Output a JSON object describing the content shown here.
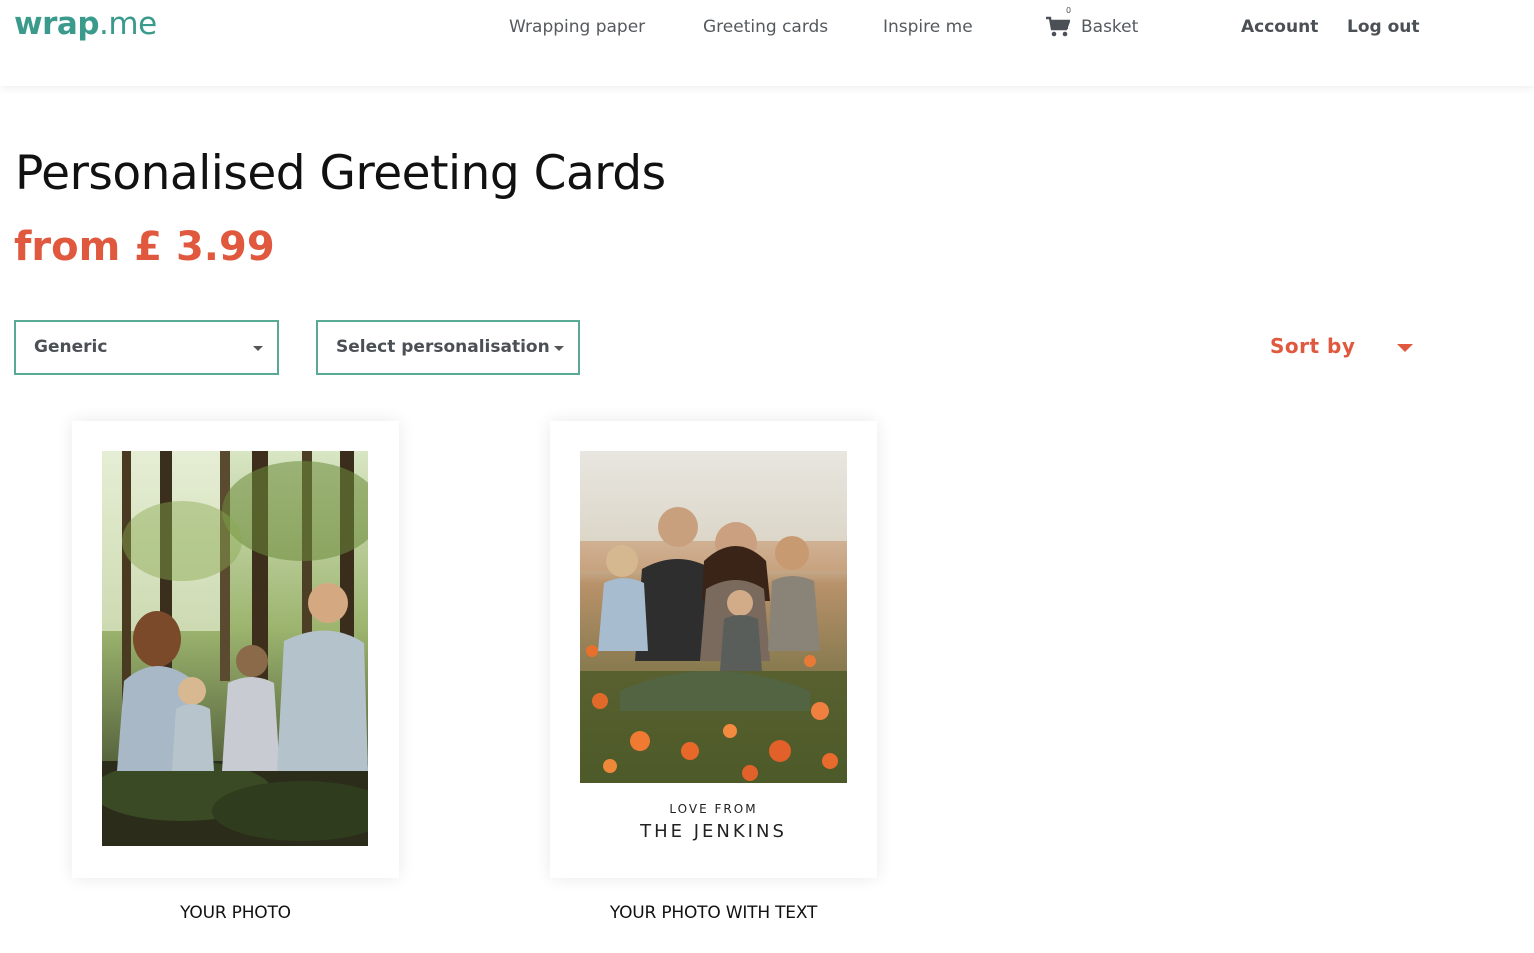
{
  "brand": {
    "logo_main": "wrap",
    "logo_suffix": ".me"
  },
  "nav": {
    "wrapping_paper": "Wrapping paper",
    "greeting_cards": "Greeting cards",
    "inspire_me": "Inspire me",
    "basket_label": "Basket",
    "basket_count": "0",
    "account": "Account",
    "logout": "Log out"
  },
  "page": {
    "title": "Personalised Greeting Cards",
    "price": "from £ 3.99"
  },
  "filters": {
    "category_value": "Generic",
    "personalisation_value": "Select personalisation",
    "sort_label": "Sort by"
  },
  "products": [
    {
      "caption": "YOUR PHOTO"
    },
    {
      "caption": "YOUR PHOTO WITH TEXT",
      "card_text_small": "LOVE FROM",
      "card_text_large": "THE JENKINS"
    }
  ],
  "colors": {
    "accent": "#e0583e",
    "brand": "#3a9a8c",
    "border": "#5aa896"
  },
  "icons": {
    "basket": "cart-icon",
    "dropdown": "chevron-down-icon"
  }
}
